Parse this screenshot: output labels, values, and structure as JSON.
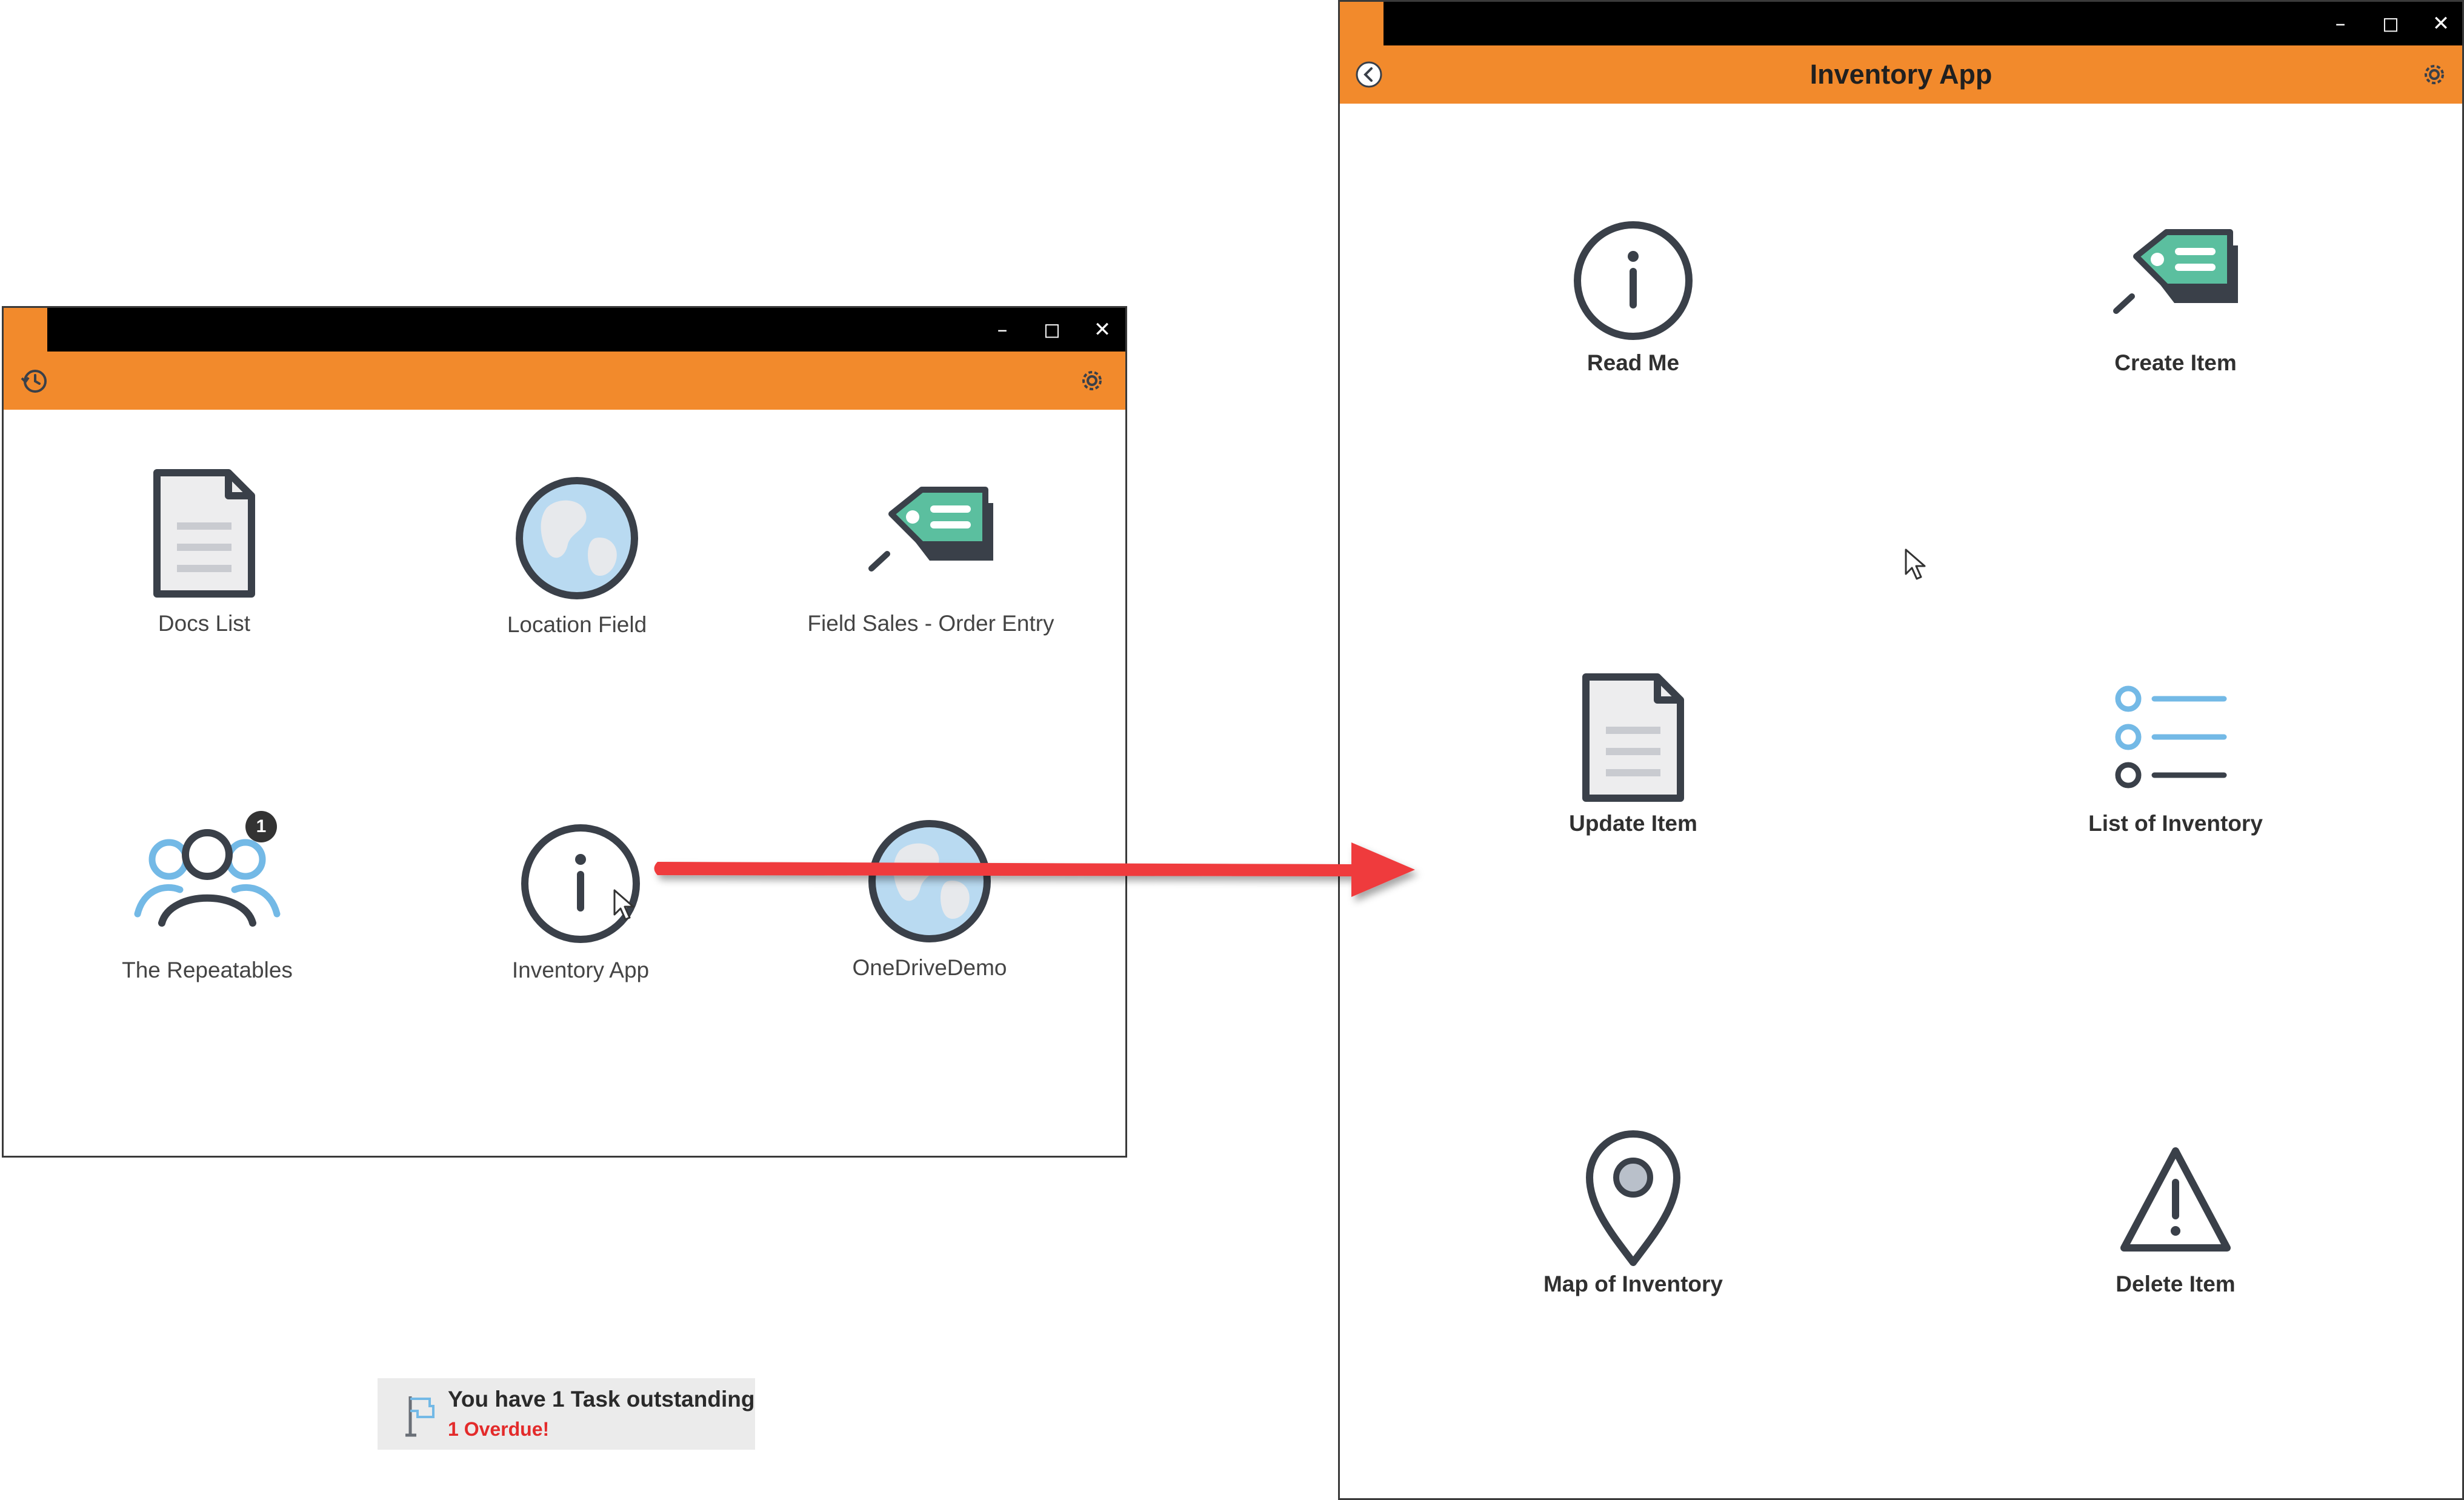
{
  "window_controls": {
    "minimize": "–",
    "maximize": "◻",
    "close": "✕"
  },
  "left_window": {
    "toolbar": {
      "history_icon": "history-icon",
      "settings_icon": "gear-icon"
    },
    "tiles": [
      {
        "label": "Docs List",
        "icon": "document-icon"
      },
      {
        "label": "Location Field",
        "icon": "globe-icon"
      },
      {
        "label": "Field Sales - Order Entry",
        "icon": "tag-icon"
      },
      {
        "label": "The Repeatables",
        "icon": "users-icon",
        "badge": "1"
      },
      {
        "label": "Inventory App",
        "icon": "info-icon"
      },
      {
        "label": "OneDriveDemo",
        "icon": "globe-icon"
      }
    ],
    "task_banner": {
      "title": "You have 1 Task outstanding",
      "overdue": "1 Overdue!",
      "icon": "flag-icon"
    }
  },
  "right_window": {
    "toolbar": {
      "title": "Inventory App",
      "back_icon": "back-icon",
      "settings_icon": "gear-icon"
    },
    "tiles": [
      {
        "label": "Read Me",
        "icon": "info-icon"
      },
      {
        "label": "Create Item",
        "icon": "tag-icon"
      },
      {
        "label": "Update Item",
        "icon": "document-icon"
      },
      {
        "label": "List of Inventory",
        "icon": "list-icon"
      },
      {
        "label": "Map of Inventory",
        "icon": "map-pin-icon"
      },
      {
        "label": "Delete Item",
        "icon": "warning-icon"
      }
    ]
  },
  "colors": {
    "accent": "#f28a2c",
    "titlebar": "#000000",
    "icon_stroke": "#3a4049",
    "tag_green": "#5bbf9f",
    "light_blue": "#73b9e6",
    "overdue_red": "#e32b2b",
    "arrow_red": "#ef3b3e"
  }
}
